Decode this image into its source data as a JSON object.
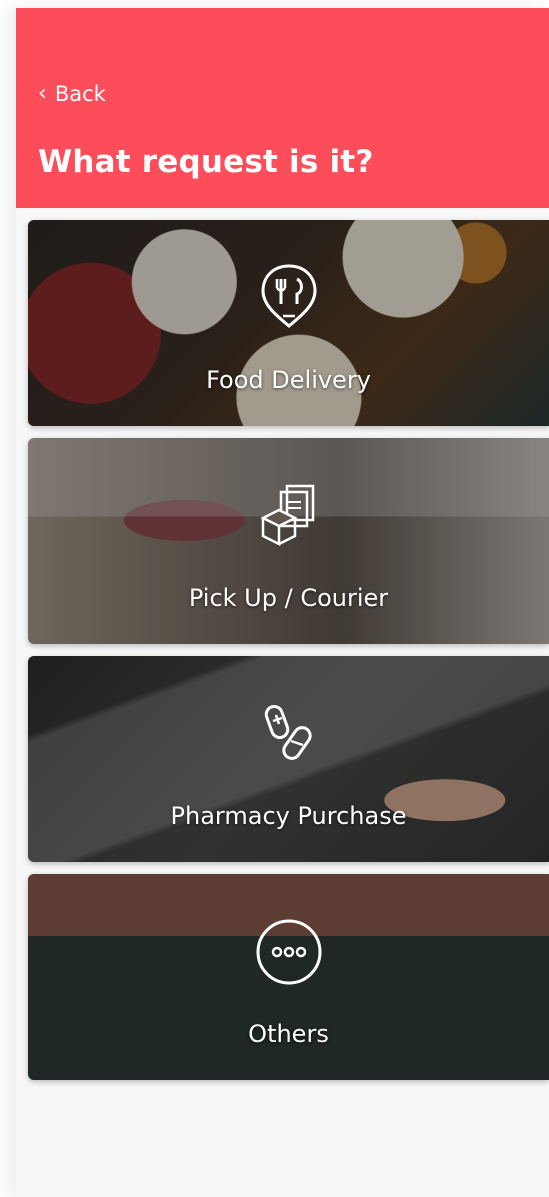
{
  "header": {
    "back_label": "Back",
    "title": "What request is it?"
  },
  "cards": [
    {
      "label": "Food Delivery",
      "icon": "food-pin-icon"
    },
    {
      "label": "Pick Up / Courier",
      "icon": "documents-box-icon"
    },
    {
      "label": "Pharmacy Purchase",
      "icon": "pills-icon"
    },
    {
      "label": "Others",
      "icon": "more-dots-icon"
    }
  ],
  "colors": {
    "header_bg": "#fd4d5a",
    "page_bg": "#f7f7f7"
  }
}
